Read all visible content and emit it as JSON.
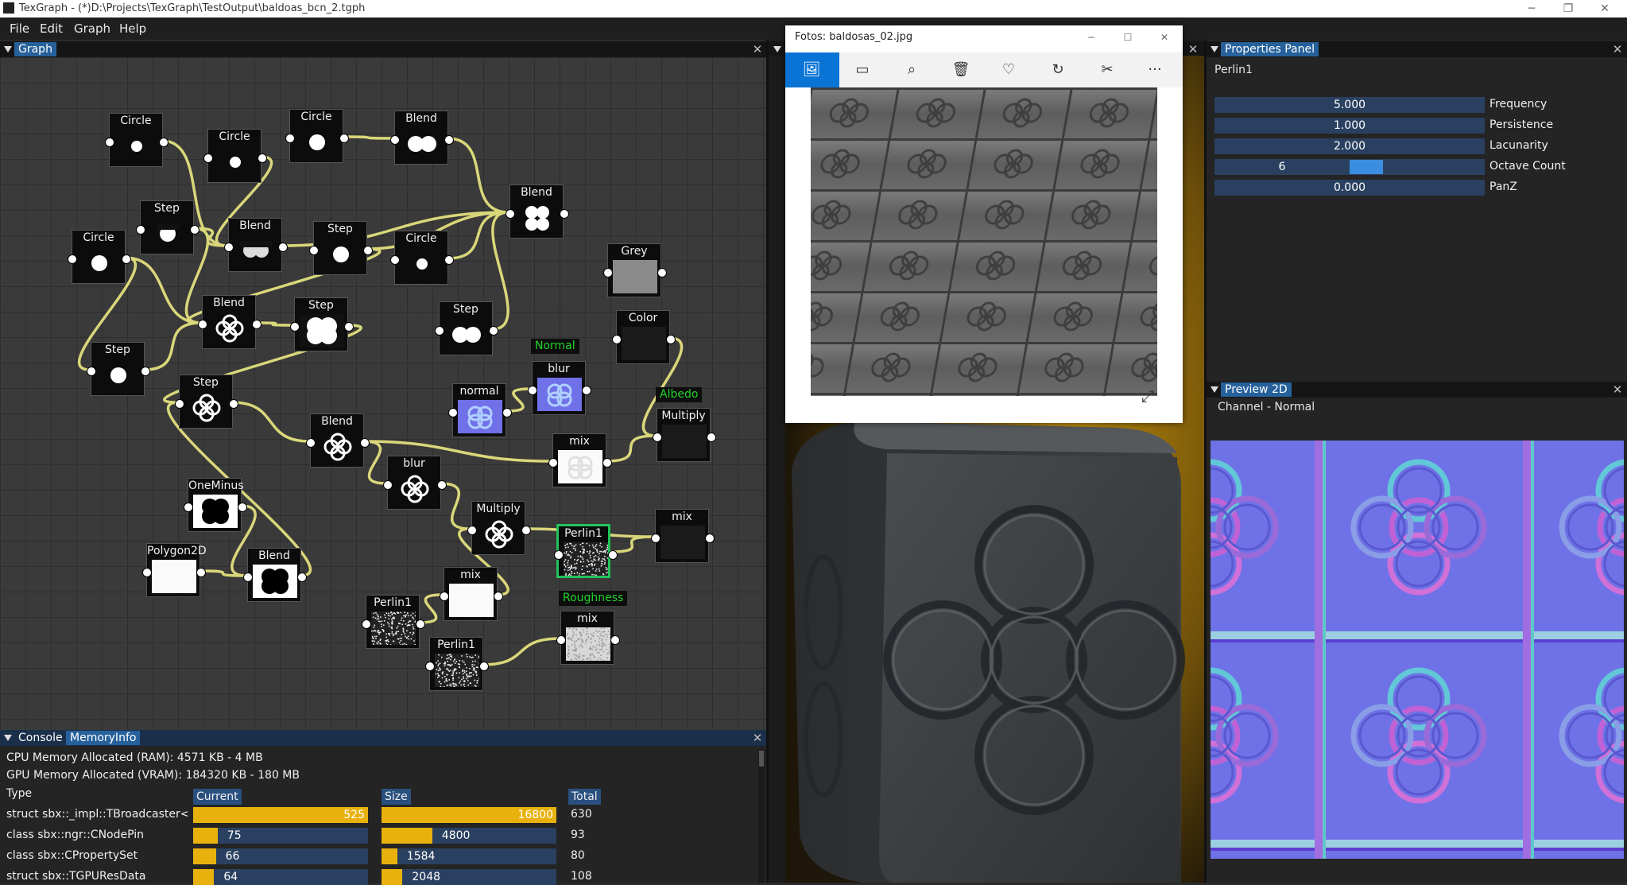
{
  "window": {
    "title": "TexGraph - (*)D:\\Projects\\TexGraph\\TestOutput\\baldoas_bcn_2.tgph",
    "minimize": "─",
    "restore": "❐",
    "close": "✕"
  },
  "menu": [
    "File",
    "Edit",
    "Graph",
    "Help"
  ],
  "graph_panel": {
    "tab": "Graph",
    "close": "✕"
  },
  "nodes": [
    {
      "label": "Circle",
      "thumb": "circle-small"
    },
    {
      "label": "Circle",
      "thumb": "circle-small"
    },
    {
      "label": "Circle",
      "thumb": "circle"
    },
    {
      "label": "Blend",
      "thumb": "two-circles"
    },
    {
      "label": "Step",
      "thumb": "circle-half"
    },
    {
      "label": "Blend",
      "thumb": "blend-dark"
    },
    {
      "label": "Step",
      "thumb": "circle"
    },
    {
      "label": "Circle",
      "thumb": "circle-small"
    },
    {
      "label": "Blend",
      "thumb": "four-circles"
    },
    {
      "label": "Circle",
      "thumb": "circle"
    },
    {
      "label": "Grey",
      "thumb": "grey"
    },
    {
      "label": "Blend",
      "thumb": "flower"
    },
    {
      "label": "Step",
      "thumb": "flower-solid"
    },
    {
      "label": "Step",
      "thumb": "two-circles"
    },
    {
      "label": "Color",
      "thumb": "dark"
    },
    {
      "label": "Step",
      "thumb": "circle"
    },
    {
      "label": "blur",
      "thumb": "normal-map"
    },
    {
      "label": "Step",
      "thumb": "flower"
    },
    {
      "label": "normal",
      "thumb": "normal-map"
    },
    {
      "label": "Multiply",
      "thumb": "dark"
    },
    {
      "label": "Blend",
      "thumb": "flower"
    },
    {
      "label": "mix",
      "thumb": "flower-light"
    },
    {
      "label": "blur",
      "thumb": "flower"
    },
    {
      "label": "OneMinus",
      "thumb": "flower-black"
    },
    {
      "label": "Multiply",
      "thumb": "flower"
    },
    {
      "label": "Perlin1",
      "thumb": "noise"
    },
    {
      "label": "mix",
      "thumb": "dark"
    },
    {
      "label": "Polygon2D",
      "thumb": "white"
    },
    {
      "label": "Blend",
      "thumb": "flower-black"
    },
    {
      "label": "mix",
      "thumb": "white"
    },
    {
      "label": "Perlin1",
      "thumb": "noise"
    },
    {
      "label": "mix",
      "thumb": "noise-light"
    },
    {
      "label": "Perlin1",
      "thumb": "noise"
    }
  ],
  "output_tags": {
    "normal": "Normal",
    "albedo": "Albedo",
    "roughness": "Roughness"
  },
  "console": {
    "tabs": [
      "Console",
      "MemoryInfo"
    ],
    "close": "✕",
    "cpu_line": "CPU Memory Allocated (RAM): 4571 KB - 4 MB",
    "gpu_line": "GPU Memory Allocated (VRAM): 184320 KB - 180 MB",
    "headers": {
      "type": "Type",
      "current": "Current",
      "size": "Size",
      "total": "Total"
    },
    "rows": [
      {
        "type": "struct sbx::_impl::TBroadcaster<Ms",
        "current": "525",
        "size": "16800",
        "total": "630",
        "current_fill": 1.0,
        "size_fill": 1.0
      },
      {
        "type": "class sbx::ngr::CNodePin",
        "current": "75",
        "size": "4800",
        "total": "93",
        "current_fill": 0.14,
        "size_fill": 0.29
      },
      {
        "type": "class sbx::CPropertySet",
        "current": "66",
        "size": "1584",
        "total": "80",
        "current_fill": 0.13,
        "size_fill": 0.09
      },
      {
        "type": "struct sbx::TGPUResData",
        "current": "64",
        "size": "2048",
        "total": "108",
        "current_fill": 0.12,
        "size_fill": 0.12
      }
    ]
  },
  "photos": {
    "title": "Fotos: baldosas_02.jpg",
    "minimize": "─",
    "maximize": "☐",
    "close": "✕",
    "toolbar": [
      {
        "name": "image-icon",
        "glyph": "🖼"
      },
      {
        "name": "slideshow-icon",
        "glyph": "▭"
      },
      {
        "name": "zoom-icon",
        "glyph": "⌕"
      },
      {
        "name": "delete-icon",
        "glyph": "🗑"
      },
      {
        "name": "favorite-icon",
        "glyph": "♡"
      },
      {
        "name": "rotate-icon",
        "glyph": "↻"
      },
      {
        "name": "edit-icon",
        "glyph": "✂"
      },
      {
        "name": "more-icon",
        "glyph": "···"
      }
    ],
    "expand_glyph": "⤢"
  },
  "properties": {
    "tab": "Properties Panel",
    "close": "✕",
    "node_name": "Perlin1",
    "rows": [
      {
        "value": "5.000",
        "label": "Frequency"
      },
      {
        "value": "1.000",
        "label": "Persistence"
      },
      {
        "value": "2.000",
        "label": "Lacunarity"
      },
      {
        "value": "6",
        "label": "Octave Count",
        "slider_fill": 0.5
      },
      {
        "value": "0.000",
        "label": "PanZ"
      }
    ]
  },
  "preview": {
    "tab": "Preview 2D",
    "close": "✕",
    "channel": "Channel - Normal"
  },
  "colors": {
    "accent": "#26619c",
    "pin": "#f2a800",
    "wire": "#d9d77a",
    "tag_green": "#22d42a",
    "bar": "#e8b10d"
  }
}
